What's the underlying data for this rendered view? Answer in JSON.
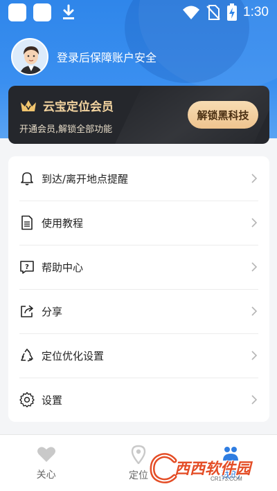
{
  "status_bar": {
    "time": "1:30",
    "icons": [
      "app-icon",
      "app-icon",
      "download-icon",
      "wifi-icon",
      "no-sim-icon",
      "battery-charging-icon"
    ]
  },
  "user": {
    "login_prompt": "登录后保障账户安全",
    "avatar": "avatar-icon"
  },
  "vip": {
    "title": "云宝定位会员",
    "subtitle": "开通会员,解锁全部功能",
    "button": "解锁黑科技",
    "icon": "crown-icon",
    "accent": "#f3d4a0"
  },
  "menu": {
    "items": [
      {
        "label": "到达/离开地点提醒",
        "icon": "bell-icon"
      },
      {
        "label": "使用教程",
        "icon": "document-icon"
      },
      {
        "label": "帮助中心",
        "icon": "help-icon"
      },
      {
        "label": "分享",
        "icon": "share-icon"
      },
      {
        "label": "定位优化设置",
        "icon": "recycle-icon"
      },
      {
        "label": "设置",
        "icon": "gear-icon"
      }
    ]
  },
  "nav": {
    "items": [
      {
        "label": "关心",
        "icon": "heart-icon"
      },
      {
        "label": "定位",
        "icon": "location-pin-icon"
      },
      {
        "label": "我的",
        "icon": "profile-icon",
        "active": true
      }
    ],
    "active_color": "#2f7de1"
  },
  "watermark": {
    "text": "西西软件园",
    "sub": "CR173.COM"
  }
}
